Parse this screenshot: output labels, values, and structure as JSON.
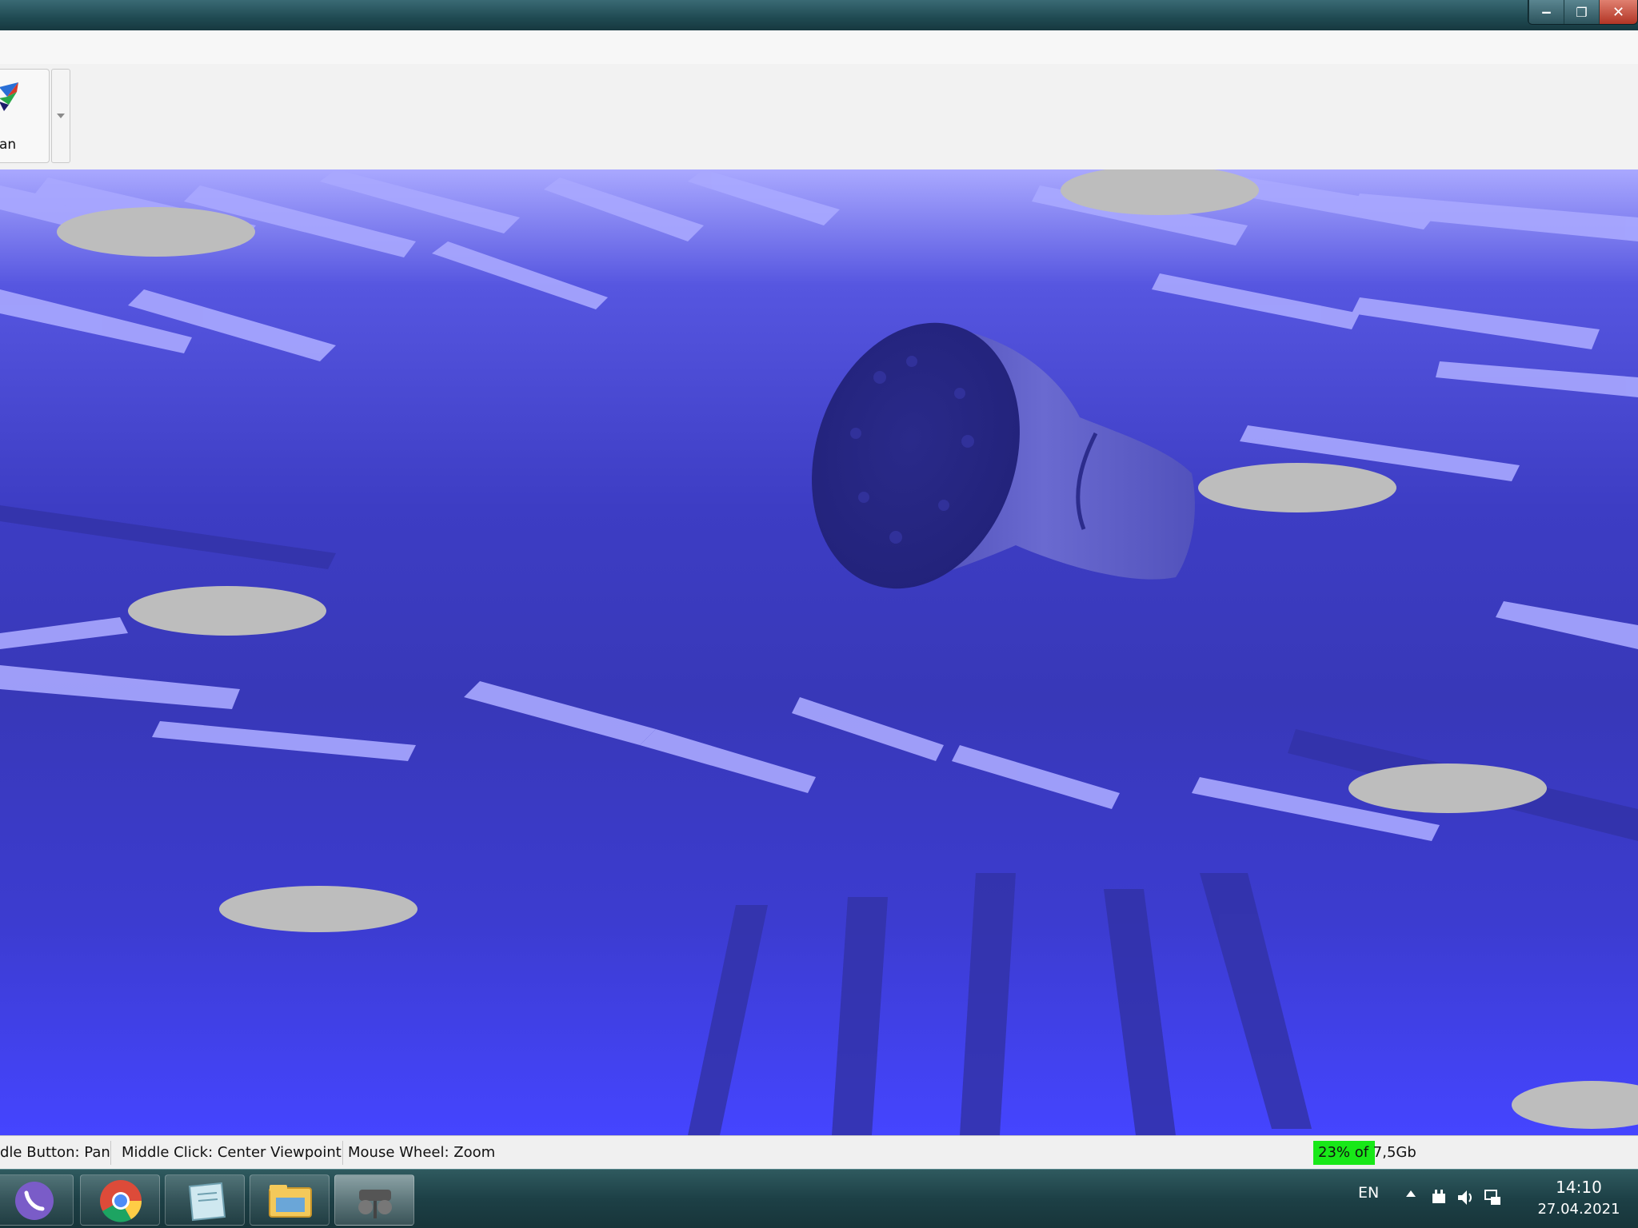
{
  "window": {
    "minimize_icon": "minimize-icon",
    "maximize_icon": "restore-icon",
    "close_icon": "close-icon"
  },
  "toolbar": {
    "scan_button_label": "an",
    "scan_icon": "scan-icon",
    "dropdown_icon": "chevron-down-icon"
  },
  "viewport": {
    "content": "3D scan point cloud with targets",
    "colors": {
      "mesh": "#3838b8",
      "highlight": "#a9a8ff",
      "target": "#bdbdbd"
    }
  },
  "statusbar": {
    "hint_pan": "dle Button: Pan",
    "hint_center": "Middle Click: Center Viewpoint",
    "hint_zoom": "Mouse Wheel: Zoom",
    "memory_text": "23% of 7,5Gb",
    "memory_fraction": 0.23
  },
  "taskbar": {
    "apps": [
      {
        "name": "viber-icon"
      },
      {
        "name": "chrome-icon"
      },
      {
        "name": "notes-icon"
      },
      {
        "name": "file-explorer-icon"
      },
      {
        "name": "scanner-app-icon"
      }
    ],
    "language": "EN",
    "time": "14:10",
    "date": "27.04.2021"
  }
}
